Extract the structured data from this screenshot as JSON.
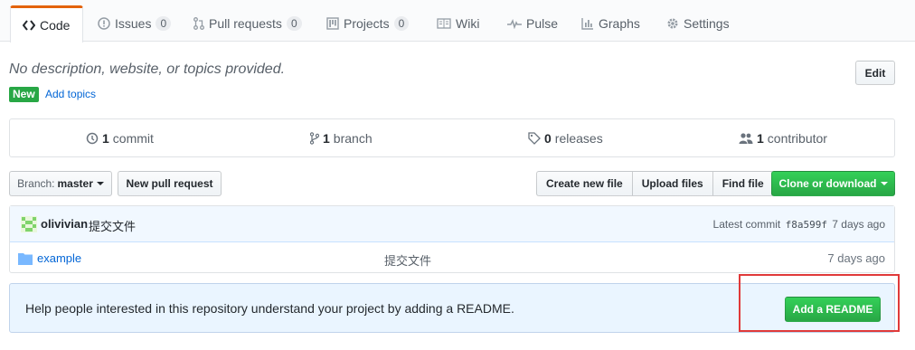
{
  "tabs": [
    {
      "label": "Code",
      "icon": "code-icon",
      "selected": true
    },
    {
      "label": "Issues",
      "count": "0",
      "icon": "issue-icon"
    },
    {
      "label": "Pull requests",
      "count": "0",
      "icon": "pull-request-icon"
    },
    {
      "label": "Projects",
      "count": "0",
      "icon": "project-icon"
    },
    {
      "label": "Wiki",
      "icon": "book-icon"
    },
    {
      "label": "Pulse",
      "icon": "pulse-icon"
    },
    {
      "label": "Graphs",
      "icon": "graph-icon"
    },
    {
      "label": "Settings",
      "icon": "gear-icon"
    }
  ],
  "repo": {
    "description": "No description, website, or topics provided.",
    "new_badge": "New",
    "add_topics": "Add topics",
    "edit_label": "Edit"
  },
  "summary": {
    "commits_count": "1",
    "commits_label": "commit",
    "branches_count": "1",
    "branches_label": "branch",
    "releases_count": "0",
    "releases_label": "releases",
    "contributors_count": "1",
    "contributors_label": "contributor"
  },
  "file_nav": {
    "branch_label": "Branch:",
    "branch_value": "master",
    "new_pull_request": "New pull request",
    "create_new_file": "Create new file",
    "upload_files": "Upload files",
    "find_file": "Find file",
    "clone_or_download": "Clone or download"
  },
  "commit_tease": {
    "author": "olivivian",
    "message": "提交文件",
    "latest_commit_label": "Latest commit",
    "sha": "f8a599f",
    "age": "7 days ago"
  },
  "files": [
    {
      "name": "example",
      "type": "folder",
      "message": "提交文件",
      "age": "7 days ago"
    }
  ],
  "readme_prompt": {
    "text": "Help people interested in this repository understand your project by adding a README.",
    "button_label": "Add a README"
  },
  "colors": {
    "accent_tab": "#e36209",
    "green": "#28a745",
    "link": "#0366d6",
    "highlight": "#e03a3a"
  }
}
